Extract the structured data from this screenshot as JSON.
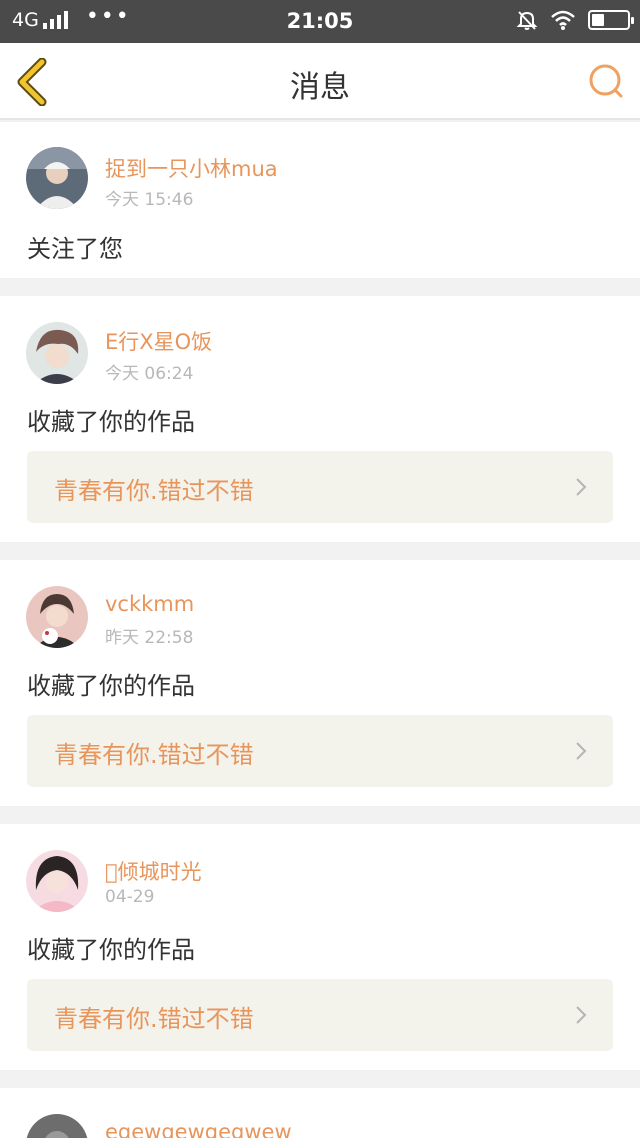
{
  "status_bar": {
    "network": "4G",
    "dots": "•••",
    "time": "21:05",
    "battery_level": 0.35
  },
  "header": {
    "title": "消息",
    "back_icon": "chevron-left-icon",
    "search_icon": "search-icon"
  },
  "messages": [
    {
      "username": "捉到一只小林mua",
      "time": "今天 15:46",
      "action": "关注了您"
    },
    {
      "username": "E行X星O饭",
      "time": "今天 06:24",
      "action": "收藏了你的作品",
      "work": "青春有你.错过不错"
    },
    {
      "username": "vckkmm",
      "time": "昨天 22:58",
      "action": "收藏了你的作品",
      "work": "青春有你.错过不错"
    },
    {
      "username": "􏰀倾城时光",
      "time": "04-29",
      "action": "收藏了你的作品",
      "work": "青春有你.错过不错"
    },
    {
      "username": "egewgewgegwew"
    }
  ],
  "colors": {
    "accent": "#e8955b",
    "back_icon": "#f0c52e",
    "status_bar_bg": "#4a4a4a",
    "link_bg": "#f3f3ec"
  }
}
